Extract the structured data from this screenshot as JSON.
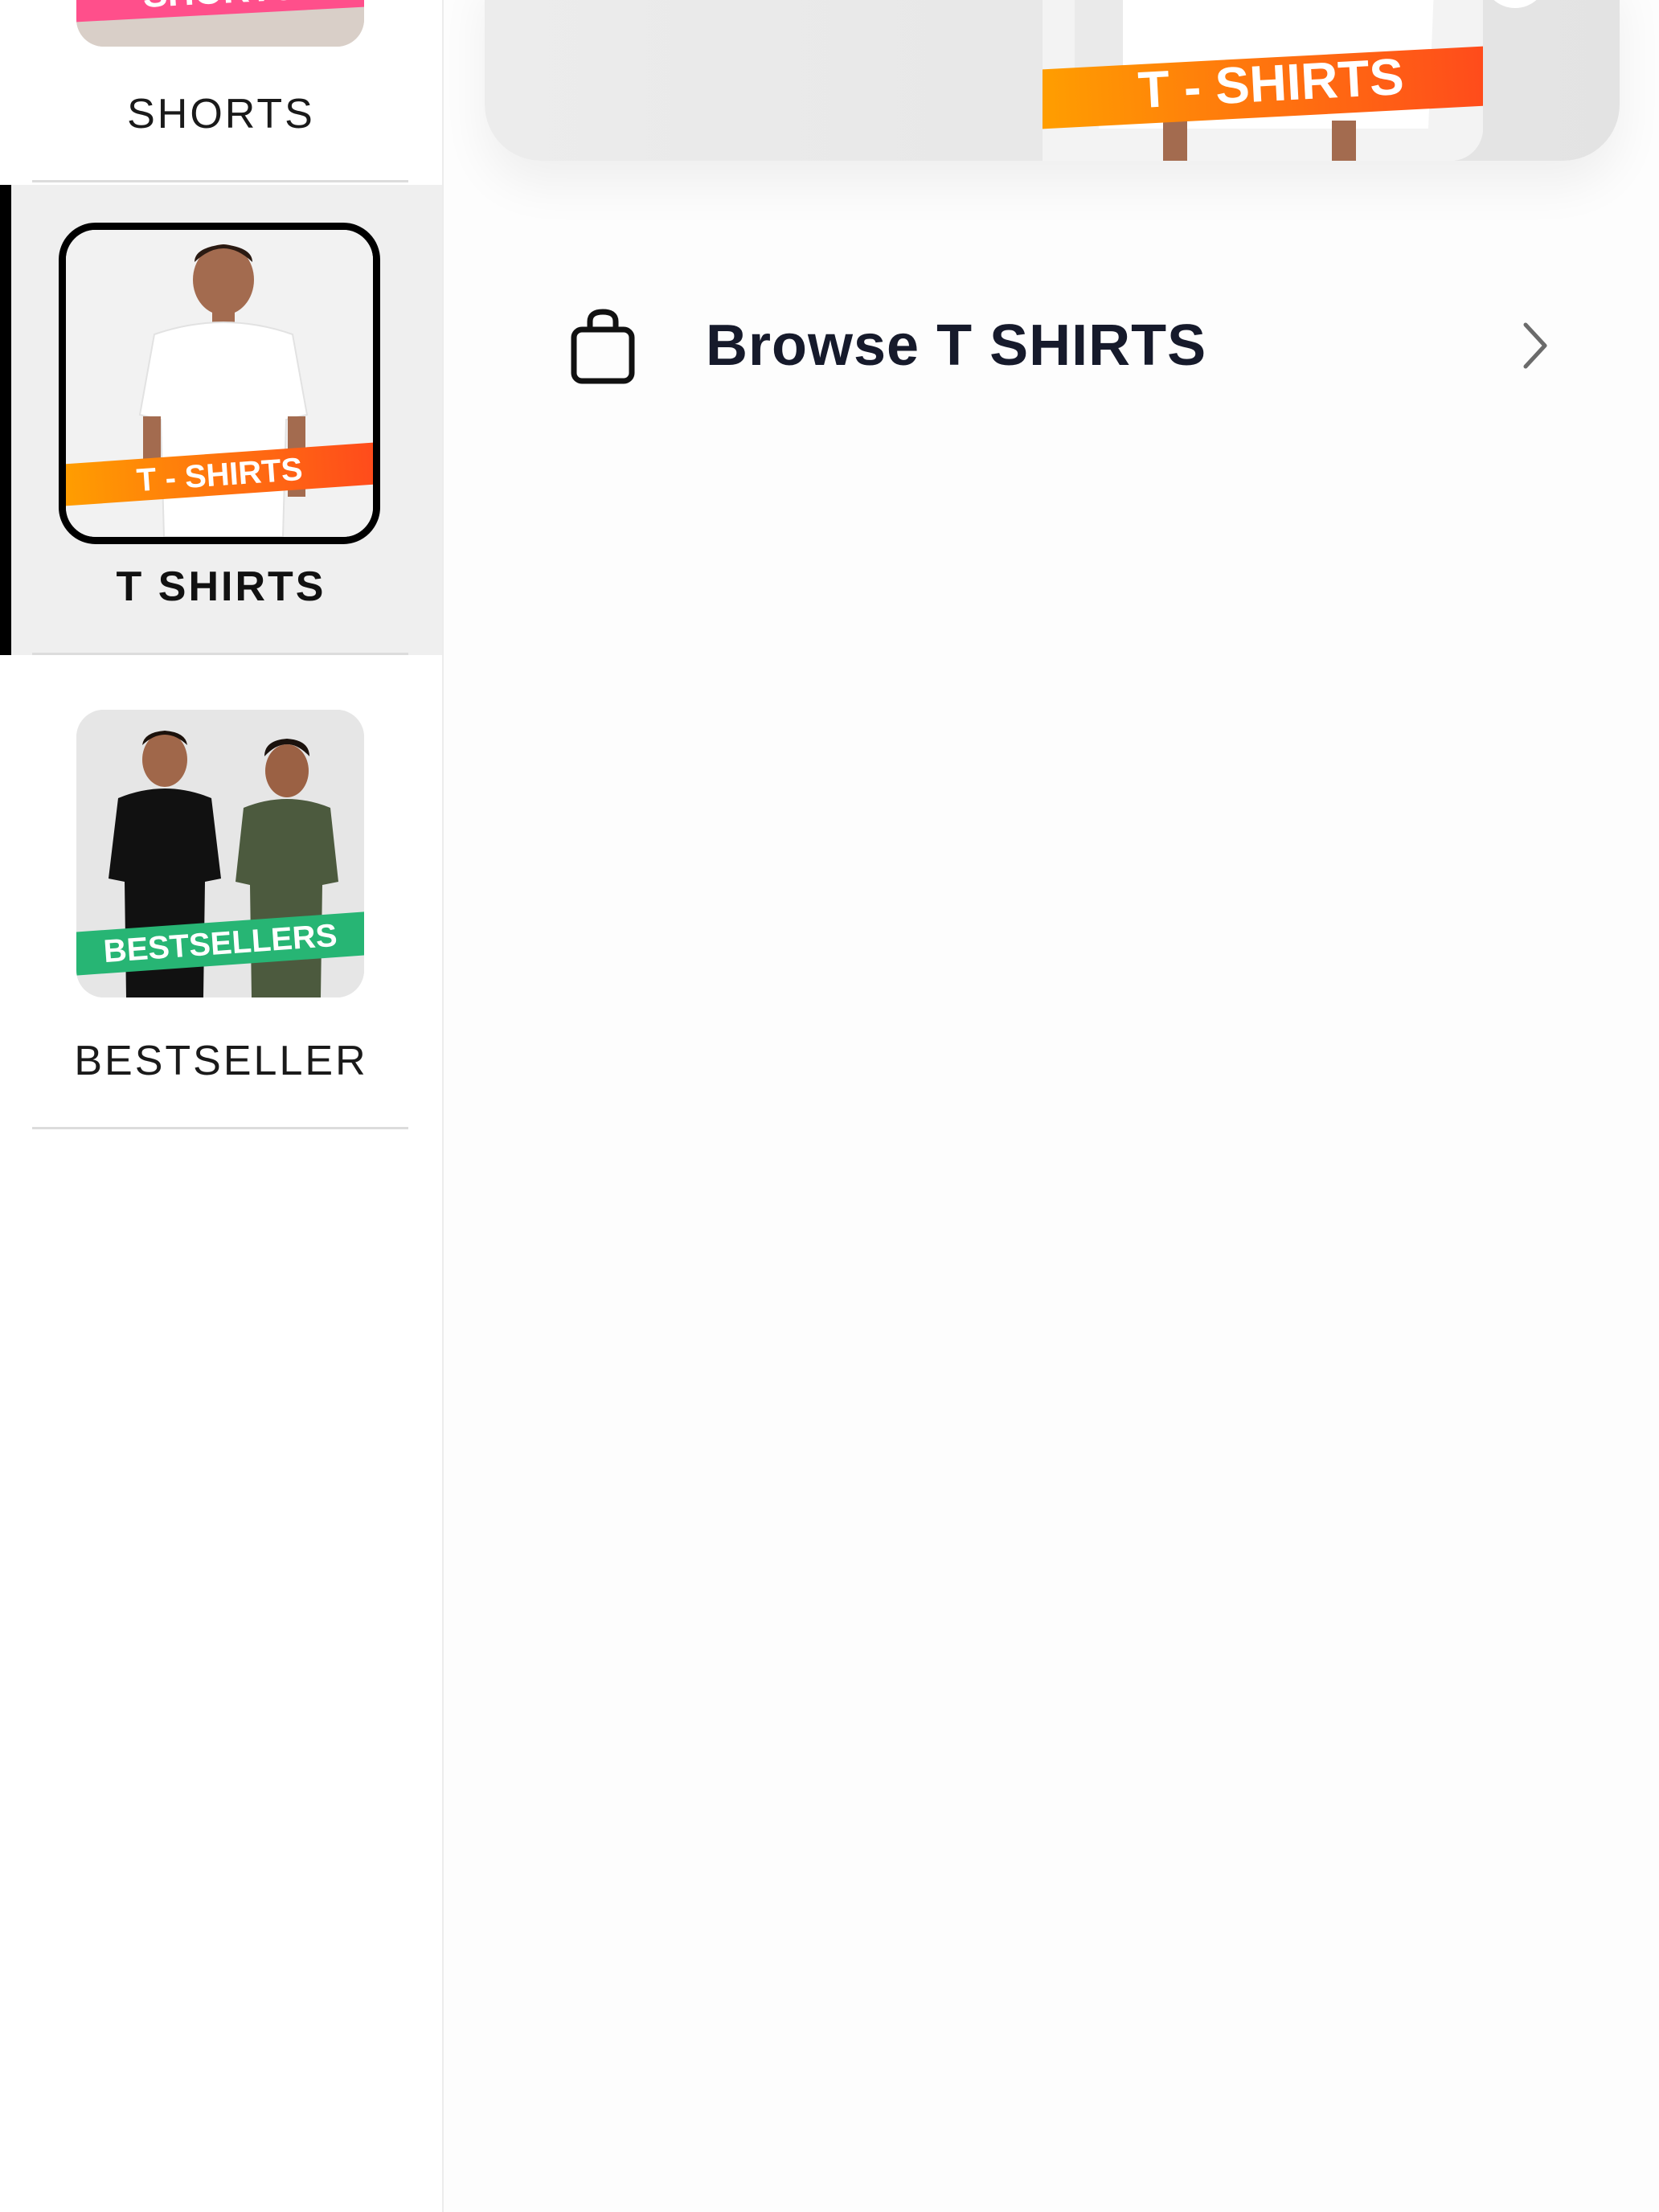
{
  "sidebar": {
    "items": [
      {
        "label": "SHORTS",
        "badge": "SHORTS"
      },
      {
        "label": "T SHIRTS",
        "badge": "T - SHIRTS",
        "active": true
      },
      {
        "label": "BESTSELLER",
        "badge": "BESTSELLERS"
      }
    ]
  },
  "banner": {
    "badge": "T - SHIRTS"
  },
  "browse": {
    "label": "Browse T SHIRTS",
    "icon": "shopping-bag-icon",
    "chevron_icon": "chevron-right-icon"
  },
  "colors": {
    "active_bar": "#000000",
    "tshirt_badge_start": "#ff9f00",
    "tshirt_badge_end": "#ff4a1c",
    "bestseller_badge": "#27b574",
    "shorts_badge": "#ff4f8b"
  }
}
